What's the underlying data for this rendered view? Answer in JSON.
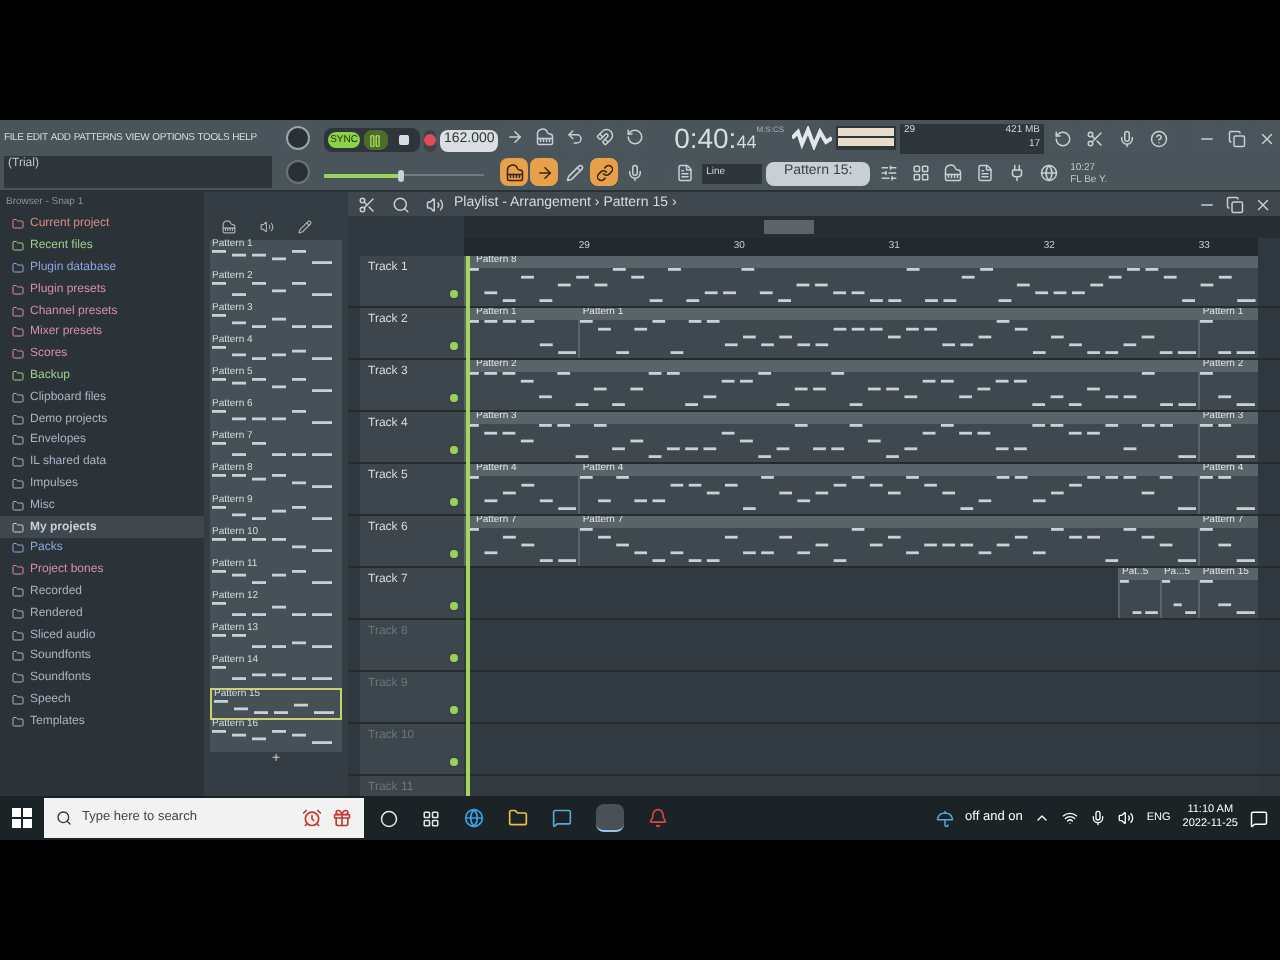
{
  "menu": [
    {
      "label": "FILE"
    },
    {
      "label": "EDIT"
    },
    {
      "label": "ADD"
    },
    {
      "label": "PATTERNS"
    },
    {
      "label": "VIEW"
    },
    {
      "label": "OPTIONS"
    },
    {
      "label": "TOOLS"
    },
    {
      "label": "HELP"
    }
  ],
  "hint": "(Trial)",
  "transport": {
    "sync": "SYNC",
    "playing": true,
    "tempo": "162.000",
    "master_volume": {
      "level": 0.47
    }
  },
  "time": {
    "value": "0:40:",
    "cs": "44",
    "unit": "M:S:CS"
  },
  "monitor": {
    "polyphony": "29",
    "memory": "421 MB",
    "cpu": "17"
  },
  "snap": "Line",
  "pattern_selector": "Pattern 15:",
  "news": {
    "line1": "10:27",
    "line2": "FL Be Y."
  },
  "browser": {
    "title": "Browser - Snap 1",
    "items": [
      {
        "label": "Current project",
        "color": "#d98c8c",
        "selected": false
      },
      {
        "label": "Recent files",
        "color": "#9fcf8a",
        "selected": false
      },
      {
        "label": "Plugin database",
        "color": "#8fa6e0",
        "selected": false
      },
      {
        "label": "Plugin presets",
        "color": "#d98cae",
        "selected": false
      },
      {
        "label": "Channel presets",
        "color": "#d98cae",
        "selected": false
      },
      {
        "label": "Mixer presets",
        "color": "#d98cae",
        "selected": false
      },
      {
        "label": "Scores",
        "color": "#d98cae",
        "selected": false
      },
      {
        "label": "Backup",
        "color": "#9fcf8a",
        "selected": false
      },
      {
        "label": "Clipboard files",
        "color": "#aab4c4",
        "selected": false
      },
      {
        "label": "Demo projects",
        "color": "#aab4c4",
        "selected": false
      },
      {
        "label": "Envelopes",
        "color": "#aab4c4",
        "selected": false
      },
      {
        "label": "IL shared data",
        "color": "#aab4c4",
        "selected": false
      },
      {
        "label": "Impulses",
        "color": "#aab4c4",
        "selected": false
      },
      {
        "label": "Misc",
        "color": "#aab4c4",
        "selected": false
      },
      {
        "label": "My projects",
        "color": "#c8d0d8",
        "selected": true
      },
      {
        "label": "Packs",
        "color": "#8fa6e0",
        "selected": false
      },
      {
        "label": "Project bones",
        "color": "#d98cae",
        "selected": false
      },
      {
        "label": "Recorded",
        "color": "#aab4c4",
        "selected": false
      },
      {
        "label": "Rendered",
        "color": "#aab4c4",
        "selected": false
      },
      {
        "label": "Sliced audio",
        "color": "#aab4c4",
        "selected": false
      },
      {
        "label": "Soundfonts",
        "color": "#aab4c4",
        "selected": false
      },
      {
        "label": "Soundfonts",
        "color": "#aab4c4",
        "selected": false
      },
      {
        "label": "Speech",
        "color": "#aab4c4",
        "selected": false
      },
      {
        "label": "Templates",
        "color": "#aab4c4",
        "selected": false
      }
    ]
  },
  "patterns": {
    "items": [
      {
        "label": "Pattern 1",
        "selected": false
      },
      {
        "label": "Pattern 2",
        "selected": false
      },
      {
        "label": "Pattern 3",
        "selected": false
      },
      {
        "label": "Pattern 4",
        "selected": false
      },
      {
        "label": "Pattern 5",
        "selected": false
      },
      {
        "label": "Pattern 6",
        "selected": false
      },
      {
        "label": "Pattern 7",
        "selected": false
      },
      {
        "label": "Pattern 8",
        "selected": false
      },
      {
        "label": "Pattern 9",
        "selected": false
      },
      {
        "label": "Pattern 10",
        "selected": false
      },
      {
        "label": "Pattern 11",
        "selected": false
      },
      {
        "label": "Pattern 12",
        "selected": false
      },
      {
        "label": "Pattern 13",
        "selected": false
      },
      {
        "label": "Pattern 14",
        "selected": false
      },
      {
        "label": "Pattern 15",
        "selected": true
      },
      {
        "label": "Pattern 16",
        "selected": false
      }
    ],
    "add": "+"
  },
  "playlist": {
    "title": "Playlist - Arrangement › Pattern 15 ›",
    "ruler": [
      "29",
      "30",
      "31",
      "32",
      "33"
    ],
    "tracks": [
      {
        "name": "Track 1",
        "empty": false,
        "clips": [
          {
            "label": "Pattern 8"
          }
        ]
      },
      {
        "name": "Track 2",
        "empty": false,
        "clips": [
          {
            "label": "Pattern 1"
          },
          {
            "label": "Pattern 1"
          },
          {
            "label": "Pattern 1"
          }
        ]
      },
      {
        "name": "Track 3",
        "empty": false,
        "clips": [
          {
            "label": "Pattern 2"
          },
          {
            "label": "Pattern 2"
          }
        ]
      },
      {
        "name": "Track 4",
        "empty": false,
        "clips": [
          {
            "label": "Pattern 3"
          },
          {
            "label": "Pattern 3"
          }
        ]
      },
      {
        "name": "Track 5",
        "empty": false,
        "clips": [
          {
            "label": "Pattern 4"
          },
          {
            "label": "Pattern 4"
          },
          {
            "label": "Pattern 4"
          }
        ]
      },
      {
        "name": "Track 6",
        "empty": false,
        "clips": [
          {
            "label": "Pattern 7"
          },
          {
            "label": "Pattern 7"
          },
          {
            "label": "Pattern 7"
          }
        ]
      },
      {
        "name": "Track 7",
        "empty": false,
        "clips": [
          {
            "label": "Pat..5"
          },
          {
            "label": "Pa...5"
          },
          {
            "label": "Pattern 15"
          }
        ]
      },
      {
        "name": "Track 8",
        "empty": true
      },
      {
        "name": "Track 9",
        "empty": true
      },
      {
        "name": "Track 10",
        "empty": true
      },
      {
        "name": "Track 11",
        "empty": true
      }
    ]
  },
  "taskbar": {
    "search_placeholder": "Type here to search",
    "weather": "off and on",
    "language": "ENG",
    "time": "11:10 AM",
    "date": "2022-11-25"
  }
}
